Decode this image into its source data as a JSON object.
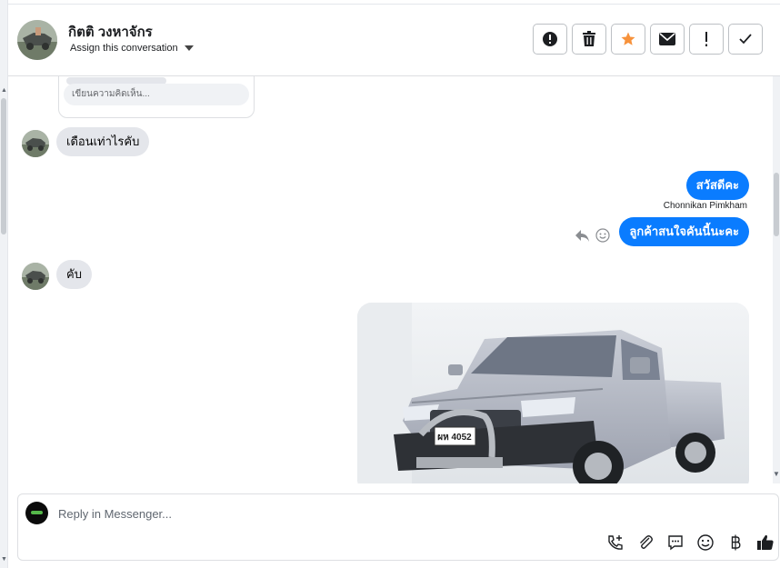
{
  "header": {
    "contact_name": "กิตติ วงหาจักร",
    "assign_label": "Assign this conversation",
    "actions": [
      {
        "name": "mark-spam-button",
        "icon": "alert-circle-icon"
      },
      {
        "name": "delete-button",
        "icon": "trash-icon"
      },
      {
        "name": "star-button",
        "icon": "star-icon"
      },
      {
        "name": "mark-unread-button",
        "icon": "envelope-icon"
      },
      {
        "name": "follow-up-button",
        "icon": "exclamation-icon"
      },
      {
        "name": "mark-done-button",
        "icon": "checkmark-icon"
      }
    ],
    "star_color": "#f7923b"
  },
  "comment": {
    "placeholder": "เขียนความคิดเห็น..."
  },
  "messages": [
    {
      "direction": "in",
      "text": "เดือนเท่าไรคับ"
    },
    {
      "direction": "out",
      "text": "สวัสดีคะ",
      "sender": "Chonnikan Pimkham"
    },
    {
      "direction": "out",
      "text": "ลูกค้าสนใจคันนี้นะคะ"
    },
    {
      "direction": "in",
      "text": "คับ"
    }
  ],
  "photo": {
    "plate_text": "ผห 4052"
  },
  "composer": {
    "placeholder": "Reply in Messenger...",
    "tools": [
      "phone-add-icon",
      "attachment-icon",
      "saved-reply-icon",
      "emoji-icon",
      "baht-icon",
      "like-icon"
    ]
  },
  "colors": {
    "outgoing_bubble": "#0a7cff",
    "incoming_bubble": "#e4e6eb"
  }
}
